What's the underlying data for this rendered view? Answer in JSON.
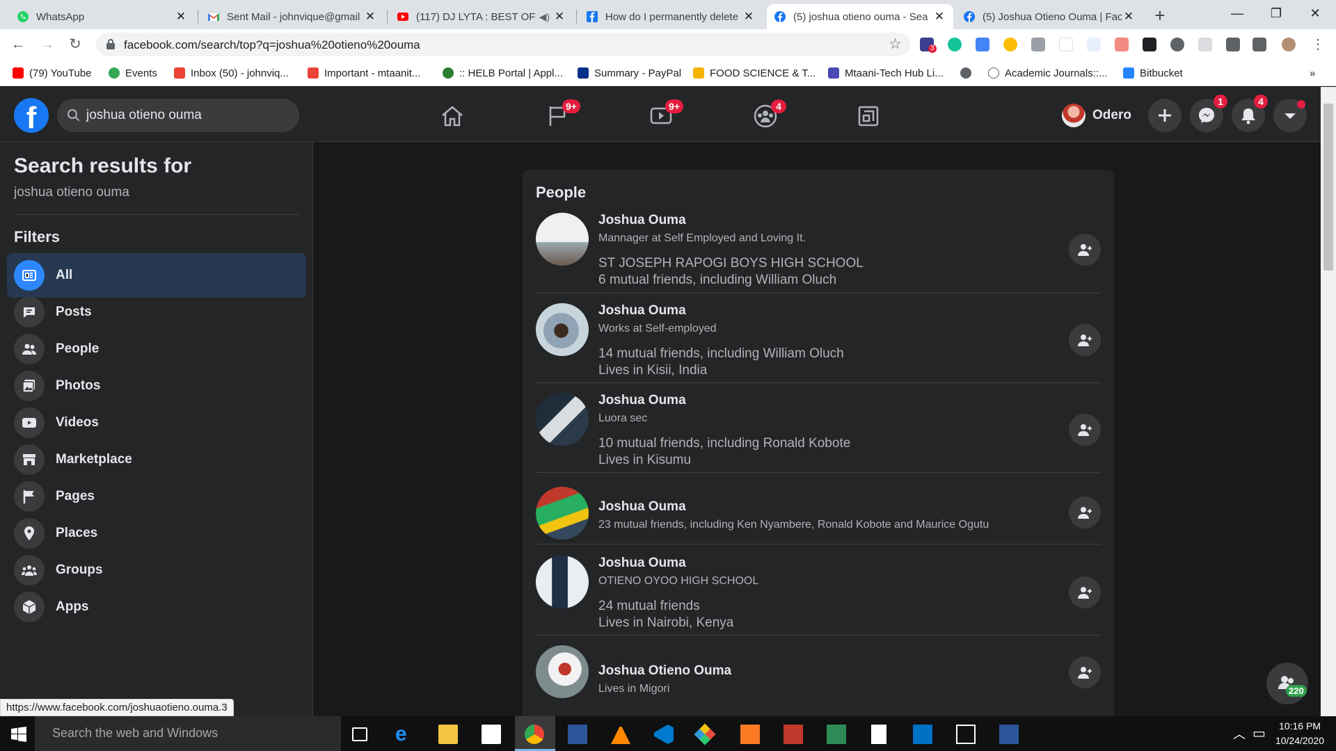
{
  "browser": {
    "tabs": [
      {
        "title": "WhatsApp"
      },
      {
        "title": "Sent Mail - johnvique@gmail"
      },
      {
        "title": "(117) DJ LYTA : BEST OF"
      },
      {
        "title": "How do I permanently delete"
      },
      {
        "title": "(5) joshua otieno ouma - Sea"
      },
      {
        "title": "(5) Joshua Otieno Ouma | Fac"
      }
    ],
    "url": "facebook.com/search/top?q=joshua%20otieno%20ouma",
    "ext_badge": "3",
    "bookmarks": [
      {
        "label": "(79) YouTube"
      },
      {
        "label": "Events"
      },
      {
        "label": "Inbox (50) - johnviq..."
      },
      {
        "label": "Important - mtaanit..."
      },
      {
        "label": ":: HELB Portal | Appl..."
      },
      {
        "label": "Summary - PayPal"
      },
      {
        "label": "FOOD SCIENCE & T..."
      },
      {
        "label": "Mtaani-Tech Hub Li..."
      },
      {
        "label": "Academic Journals::..."
      },
      {
        "label": "Bitbucket"
      }
    ],
    "bookmarks_more": "»",
    "status_url": "https://www.facebook.com/joshuaotieno.ouma.3"
  },
  "fb": {
    "search_query": "joshua otieno ouma",
    "nav_badges": {
      "watch": "9+",
      "marketplace": "9+",
      "groups": "4"
    },
    "profile_name": "Odero",
    "messenger_badge": "1",
    "notifications_badge": "4",
    "sidebar": {
      "title": "Search results for",
      "query": "joshua otieno ouma",
      "filters_heading": "Filters",
      "filters": [
        "All",
        "Posts",
        "People",
        "Photos",
        "Videos",
        "Marketplace",
        "Pages",
        "Places",
        "Groups",
        "Apps"
      ]
    },
    "people": {
      "heading": "People",
      "results": [
        {
          "name": "Joshua Ouma",
          "line1": "Mannager at Self Employed and Loving It.",
          "line2": "ST JOSEPH RAPOGI BOYS HIGH SCHOOL",
          "line3": "6 mutual friends, including William Oluch"
        },
        {
          "name": "Joshua Ouma",
          "line1": "Works at Self-employed",
          "line2": "14 mutual friends, including William Oluch",
          "line3": "Lives in Kisii, India"
        },
        {
          "name": "Joshua Ouma",
          "line1": "Luora sec",
          "line2": "10 mutual friends, including Ronald Kobote",
          "line3": "Lives in Kisumu"
        },
        {
          "name": "Joshua Ouma",
          "line1": "23 mutual friends, including Ken Nyambere, Ronald Kobote and Maurice Ogutu"
        },
        {
          "name": "Joshua Ouma",
          "line1": "OTIENO OYOO HIGH SCHOOL",
          "line2": "24 mutual friends",
          "line3": "Lives in Nairobi, Kenya"
        },
        {
          "name": "Joshua Otieno Ouma",
          "line1": "Lives in Migori"
        }
      ]
    },
    "contacts_count": "220"
  },
  "taskbar": {
    "search_placeholder": "Search the web and Windows",
    "time": "10:16 PM",
    "date": "10/24/2020"
  }
}
